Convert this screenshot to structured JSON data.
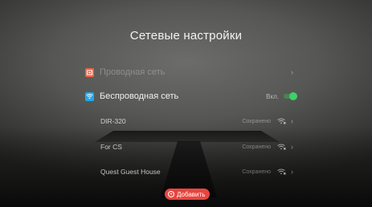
{
  "screen": {
    "title": "Сетевые настройки"
  },
  "wired": {
    "label": "Проводная сеть",
    "icon": "ethernet-icon",
    "icon_color": "#f0674a",
    "chevron": "›"
  },
  "wireless": {
    "label": "Беспроводная сеть",
    "icon": "wifi-icon",
    "icon_color": "#27a7e6",
    "state": "Вкл.",
    "enabled": true,
    "toggle_color": "#3fd06a"
  },
  "networks": [
    {
      "ssid": "DIR-320",
      "status": "Сохранено",
      "icon": "wifi-lock-icon",
      "chevron": "›"
    },
    {
      "ssid": "For CS",
      "status": "Сохранено",
      "icon": "wifi-lock-icon",
      "chevron": "›"
    },
    {
      "ssid": "Quest Guest House",
      "status": "Сохранено",
      "icon": "wifi-lock-icon",
      "chevron": "›"
    }
  ],
  "add_button": {
    "label": "Добавить",
    "icon": "plus-circle-icon",
    "color": "#e8453f"
  }
}
